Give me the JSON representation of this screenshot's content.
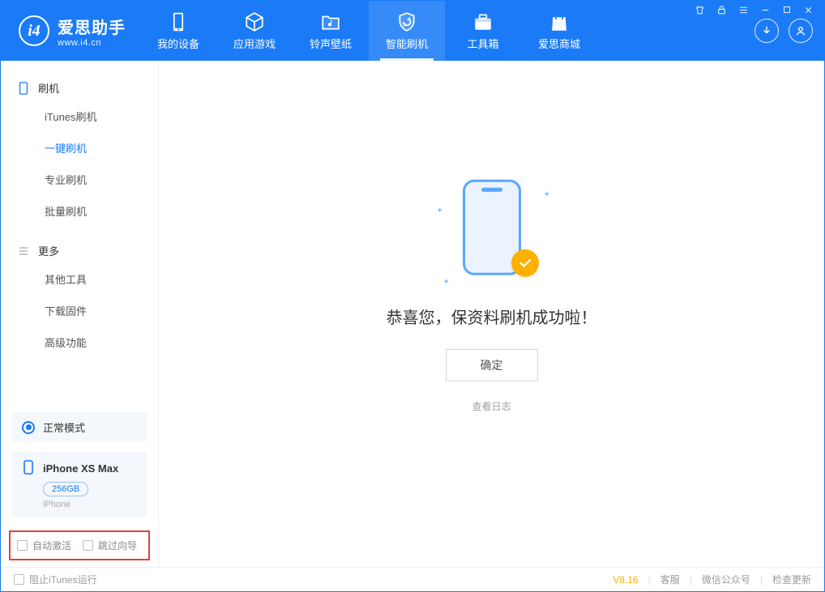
{
  "brand": {
    "name": "爱思助手",
    "url": "www.i4.cn"
  },
  "nav": {
    "items": [
      {
        "label": "我的设备"
      },
      {
        "label": "应用游戏"
      },
      {
        "label": "铃声壁纸"
      },
      {
        "label": "智能刷机"
      },
      {
        "label": "工具箱"
      },
      {
        "label": "爱思商城"
      }
    ]
  },
  "sidebar": {
    "section_flash": {
      "title": "刷机",
      "items": [
        "iTunes刷机",
        "一键刷机",
        "专业刷机",
        "批量刷机"
      ]
    },
    "section_more": {
      "title": "更多",
      "items": [
        "其他工具",
        "下载固件",
        "高级功能"
      ]
    },
    "mode_label": "正常模式",
    "device": {
      "name": "iPhone XS Max",
      "capacity": "256GB",
      "type": "iPhone"
    },
    "options": {
      "auto_activate": "自动激活",
      "skip_wizard": "跳过向导"
    }
  },
  "main": {
    "success_msg": "恭喜您，保资料刷机成功啦！",
    "ok_label": "确定",
    "view_log": "查看日志"
  },
  "footer": {
    "block_itunes": "阻止iTunes运行",
    "version": "V8.16",
    "links": [
      "客服",
      "微信公众号",
      "检查更新"
    ]
  }
}
